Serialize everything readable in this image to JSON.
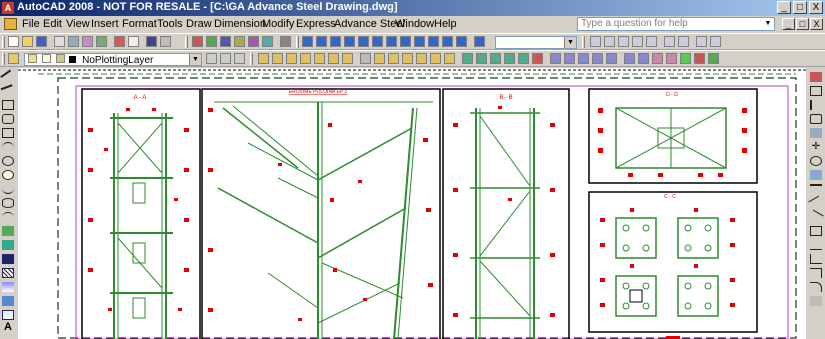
{
  "window": {
    "title": "AutoCAD 2008 - NOT FOR RESALE - [C:\\GA Advance Steel Drawing.dwg]",
    "app_icon_letter": "A",
    "controls": [
      "_",
      "□",
      "X"
    ]
  },
  "menu": {
    "items": [
      "File",
      "Edit",
      "View",
      "Insert",
      "Format",
      "Tools",
      "Draw",
      "Dimension",
      "Modify",
      "Express",
      "Advance Steel",
      "Window",
      "Help"
    ],
    "help_placeholder": "Type a question for help",
    "doc_controls": [
      "_",
      "□",
      "X"
    ]
  },
  "toolbar2": {
    "layer_combo_value": "NoPlottingLayer"
  },
  "drawing": {
    "views": [
      {
        "label": "A - A"
      },
      {
        "label": "EROVIME POLOINA EP 1"
      },
      {
        "label": "B - B"
      },
      {
        "label": "D - D"
      },
      {
        "label": "C - C"
      }
    ]
  },
  "colors": {
    "beam_green": "#2e8b2e",
    "dim_red": "#e00000",
    "frame_black": "#000000",
    "border_magenta": "#c040c0",
    "title_bar_start": "#0a246a",
    "title_bar_end": "#a6caf0"
  }
}
